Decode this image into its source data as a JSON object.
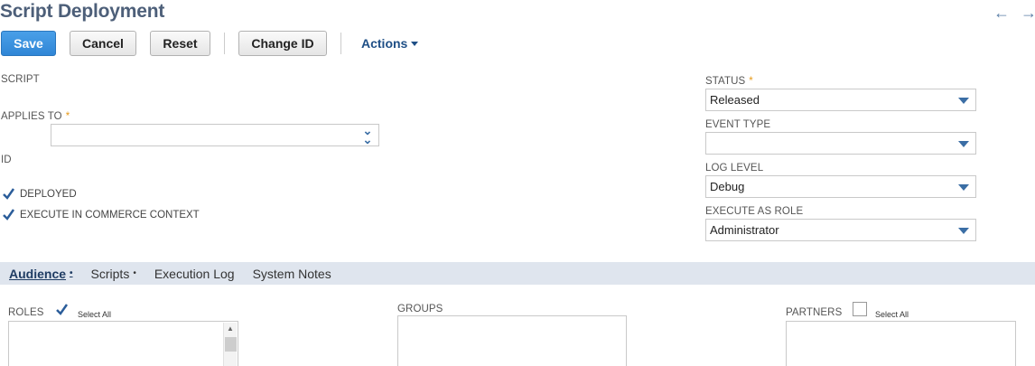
{
  "page": {
    "title": "Script Deployment"
  },
  "nav": {
    "back_icon": "arrow-left-icon",
    "forward_icon": "arrow-right-icon"
  },
  "toolbar": {
    "save_label": "Save",
    "cancel_label": "Cancel",
    "reset_label": "Reset",
    "change_id_label": "Change ID",
    "actions_label": "Actions"
  },
  "form": {
    "script_label": "SCRIPT",
    "applies_to_label": "APPLIES TO",
    "applies_to_value": "",
    "id_label": "ID",
    "deployed_label": "DEPLOYED",
    "deployed_checked": true,
    "execute_commerce_label": "EXECUTE IN COMMERCE CONTEXT",
    "execute_commerce_checked": true,
    "status_label": "STATUS",
    "status_value": "Released",
    "event_type_label": "EVENT TYPE",
    "event_type_value": "",
    "log_level_label": "LOG LEVEL",
    "log_level_value": "Debug",
    "execute_as_role_label": "EXECUTE AS ROLE",
    "execute_as_role_value": "Administrator",
    "required_marker": "*"
  },
  "tabs": [
    {
      "label": "Audience",
      "marker": "•",
      "active": true
    },
    {
      "label": "Scripts",
      "marker": "•",
      "active": false
    },
    {
      "label": "Execution Log",
      "marker": "",
      "active": false
    },
    {
      "label": "System Notes",
      "marker": "",
      "active": false
    }
  ],
  "audience": {
    "roles_label": "ROLES",
    "roles_select_all_label": "Select All",
    "roles_select_all_checked": true,
    "groups_label": "GROUPS",
    "partners_label": "PARTNERS",
    "partners_select_all_label": "Select All",
    "partners_select_all_checked": false
  },
  "colors": {
    "accent": "#2f86d6",
    "title": "#4d5f79",
    "tabbar": "#dfe5ee",
    "required": "#e79a1a"
  }
}
